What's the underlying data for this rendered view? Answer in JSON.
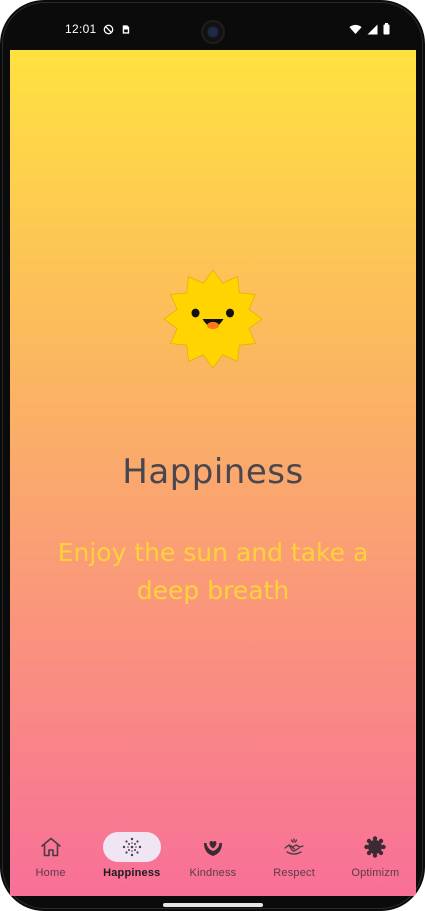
{
  "status_bar": {
    "time": "12:01",
    "icons": [
      "do-not-disturb-icon",
      "sim-card-icon",
      "wifi-icon",
      "signal-icon",
      "battery-icon"
    ]
  },
  "content": {
    "title": "Happiness",
    "subtitle": "Enjoy the sun and take a deep breath",
    "illustration": "smiling-sun-icon"
  },
  "bottom_nav": {
    "selected": "Happiness",
    "items": [
      {
        "label": "Home",
        "icon": "home-icon"
      },
      {
        "label": "Happiness",
        "icon": "sparkle-dots-icon"
      },
      {
        "label": "Kindness",
        "icon": "hands-heart-icon"
      },
      {
        "label": "Respect",
        "icon": "handshake-icon"
      },
      {
        "label": "Optimizm",
        "icon": "sunflower-icon"
      }
    ]
  },
  "colors": {
    "gradient_top": "#ffe140",
    "gradient_bottom": "#f86f98",
    "title": "#4a4650",
    "subtitle": "#ffd23a",
    "sun": "#ffd400",
    "nav_active_pill": "#f0e5f2"
  }
}
